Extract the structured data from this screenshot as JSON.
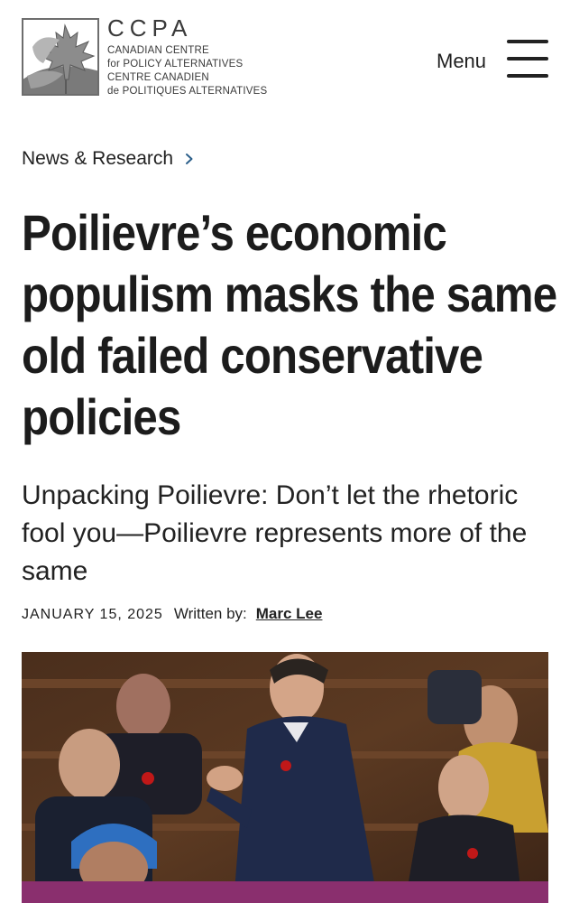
{
  "header": {
    "brand": {
      "acronym": "CCPA",
      "name_en_line1": "CANADIAN CENTRE",
      "name_en_line2": "for POLICY ALTERNATIVES",
      "name_fr_line1": "CENTRE CANADIEN",
      "name_fr_line2": "de POLITIQUES ALTERNATIVES"
    },
    "menu_label": "Menu",
    "menu_icon": "hamburger-icon"
  },
  "breadcrumb": {
    "label": "News & Research",
    "icon": "chevron-right-icon"
  },
  "article": {
    "title": "Poilievre’s economic populism masks the same old failed conservative policies",
    "subtitle": "Unpacking Poilievre: Don’t let the rhetoric fool you—Poilievre represents more of the same",
    "date": "JANUARY 15, 2025",
    "written_by_label": "Written by:",
    "author": "Marc Lee"
  },
  "colors": {
    "text": "#1f1f1f",
    "accent_bar": "#8a2f6e",
    "logo_border": "#6d6d6d"
  }
}
